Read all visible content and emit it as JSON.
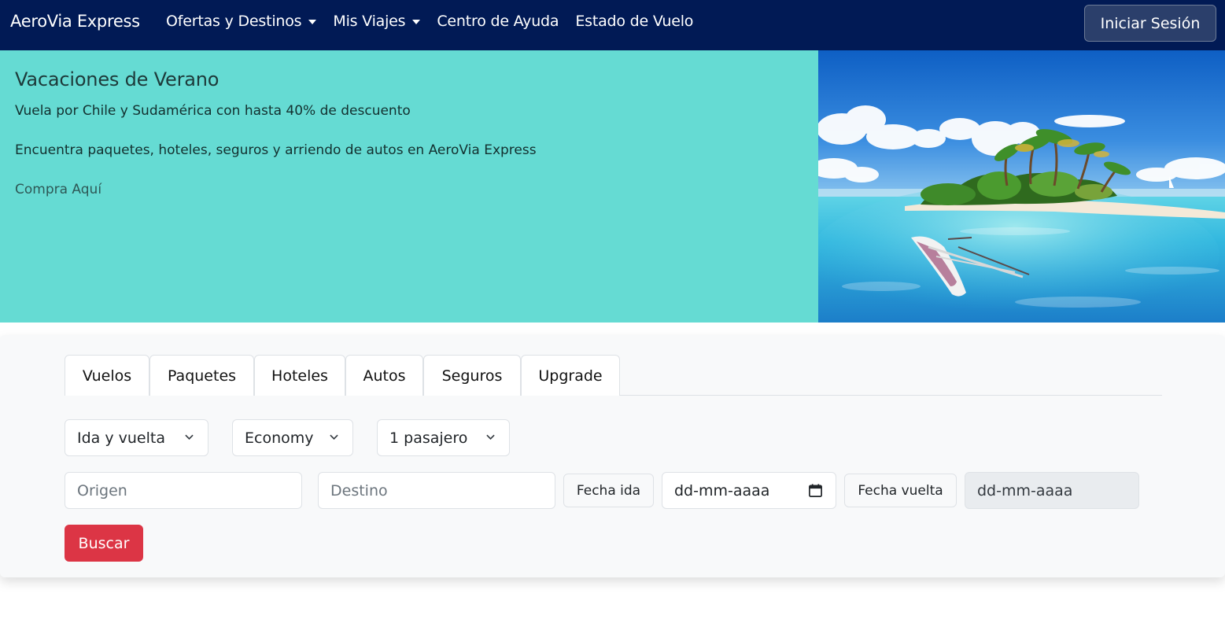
{
  "navbar": {
    "brand": "AeroVia Express",
    "links": [
      {
        "label": "Ofertas y Destinos",
        "dropdown": true
      },
      {
        "label": "Mis Viajes",
        "dropdown": true
      },
      {
        "label": "Centro de Ayuda",
        "dropdown": false
      },
      {
        "label": "Estado de Vuelo",
        "dropdown": false
      }
    ],
    "login_label": "Iniciar Sesión"
  },
  "hero": {
    "title": "Vacaciones de Verano",
    "subtitle": "Vuela por Chile y Sudamérica con hasta 40% de descuento",
    "description": "Encuentra paquetes, hoteles, seguros y arriendo de autos en AeroVia Express",
    "link_label": "Compra Aquí",
    "background_color": "#65dbd3"
  },
  "search": {
    "tabs": [
      "Vuelos",
      "Paquetes",
      "Hoteles",
      "Autos",
      "Seguros",
      "Upgrade"
    ],
    "trip_type": "Ida y vuelta",
    "cabin_class": "Economy",
    "passengers": "1 pasajero",
    "origin_placeholder": "Origen",
    "destination_placeholder": "Destino",
    "departure_label": "Fecha ida",
    "departure_value": "dd-mm-aaaa",
    "return_label": "Fecha vuelta",
    "return_value": "dd-mm-aaaa",
    "submit_label": "Buscar"
  },
  "colors": {
    "navbar": "#011a55",
    "hero": "#65dbd3",
    "primary_action": "#dc3545"
  }
}
